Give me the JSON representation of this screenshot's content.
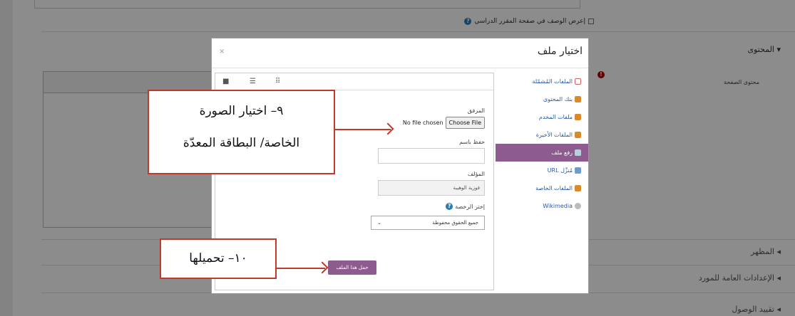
{
  "page": {
    "show_description": "إعرض الوصف في صفحة المقرر الدراسي",
    "content_section": "▾ المحتوى",
    "page_content_label": "محتوى الصفحة",
    "appearance_section": "◂ المظهر",
    "common_settings_section": "◂ الإعدادات العامة للمورد",
    "access_section": "◂ تقييد الوصول"
  },
  "dialog": {
    "title": "اختيار ملف",
    "close": "×",
    "repositories": [
      {
        "label": "الملفات المُشمّلة",
        "icon": "file-icon"
      },
      {
        "label": "بنك المحتوى",
        "icon": "content-bank-icon"
      },
      {
        "label": "ملفات المخدم",
        "icon": "server-files-icon"
      },
      {
        "label": "الملفات الأخيرة",
        "icon": "recent-files-icon"
      },
      {
        "label": "رفع ملف",
        "icon": "upload-icon"
      },
      {
        "label": "مُنزِّل URL",
        "icon": "url-icon"
      },
      {
        "label": "الملفات الخاصة",
        "icon": "private-files-icon"
      },
      {
        "label": "Wikimedia",
        "icon": "wikimedia-icon"
      }
    ],
    "attachment_label": "المرفق",
    "no_file": "No file chosen",
    "choose_file": "Choose File",
    "save_as_label": "حفظ باسم",
    "author_label": "المؤلف",
    "author_value": "فوزية الوهيبة",
    "license_label": "إختر الرخصة",
    "license_value": "جميع الحقوق محفوظة",
    "upload_button": "حمل هذا الملف"
  },
  "annotations": {
    "step9_line1": "٩– اختيار الصورة",
    "step9_line2": "الخاصة/ البطاقة المعدّة",
    "step10": "١٠– تحميلها"
  },
  "colors": {
    "accent": "#8e5b8e",
    "callout_border": "#c0392b",
    "link": "#2a5aa4"
  }
}
